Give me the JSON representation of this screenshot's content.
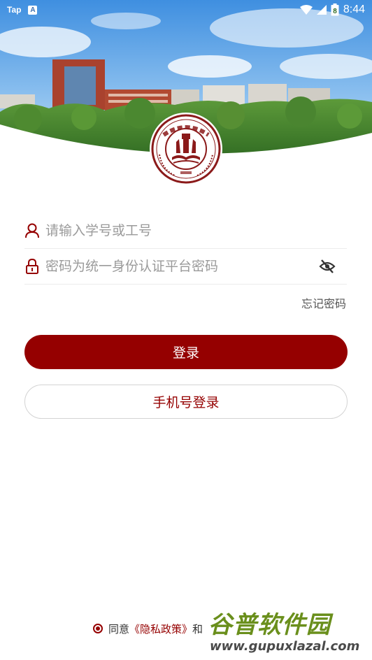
{
  "status_bar": {
    "app_label": "Tap",
    "keyboard_badge": "A",
    "battery_level": "8",
    "time": "8:44"
  },
  "login": {
    "username_placeholder": "请输入学号或工号",
    "password_placeholder": "密码为统一身份认证平台密码",
    "forgot_password": "忘记密码",
    "login_button": "登录",
    "phone_login_button": "手机号登录"
  },
  "agreement": {
    "prefix": "同意",
    "privacy_link": "《隐私政策》",
    "suffix": "和"
  },
  "watermark": {
    "brand": "谷普软件园",
    "url": "www.gupuxlazal.com"
  },
  "colors": {
    "primary": "#950000",
    "placeholder": "#9a9a9a",
    "sky": "#5fa2e0",
    "trees": "#3f7d2a"
  },
  "icons": {
    "user": "user-icon",
    "lock": "lock-icon",
    "eye": "eye-off-icon",
    "wifi": "wifi-icon",
    "signal": "signal-icon",
    "battery": "battery-icon"
  }
}
